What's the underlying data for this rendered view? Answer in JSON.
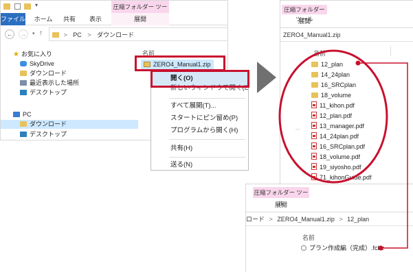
{
  "left_window": {
    "ribbon": {
      "context_header": "圧縮フォルダー ツール",
      "tabs": [
        "ファイル",
        "ホーム",
        "共有",
        "表示",
        "展開"
      ]
    },
    "address": {
      "crumb_1": "PC",
      "sep": ">",
      "crumb_2": "ダウンロード"
    },
    "nav": {
      "favorites": "お気に入り",
      "skydrive": "SkyDrive",
      "downloads": "ダウンロード",
      "recent": "最近表示した場所",
      "desktop": "デスクトップ",
      "pc": "PC",
      "pc_downloads": "ダウンロード",
      "pc_desktop": "デスクトップ"
    },
    "column_name": "名前",
    "zip_file": "ZERO4_Manual1.zip"
  },
  "context_menu": {
    "items": [
      "開く(O)",
      "新しいウィンドウで開く(E)",
      "すべて展開(T)...",
      "スタートにピン留め(P)",
      "プログラムから開く(H)",
      "共有(H)",
      "送る(N)"
    ]
  },
  "right_window": {
    "ribbon": {
      "context_header": "圧縮フォルダー ツール",
      "tab": "展開"
    },
    "address": "ZERO4_Manual1.zip",
    "column_name": "名前",
    "files": [
      {
        "name": "12_plan",
        "type": "folder"
      },
      {
        "name": "14_24plan",
        "type": "folder"
      },
      {
        "name": "16_SRCplan",
        "type": "folder"
      },
      {
        "name": "18_volume",
        "type": "folder"
      },
      {
        "name": "11_kihon.pdf",
        "type": "pdf"
      },
      {
        "name": "12_plan.pdf",
        "type": "pdf"
      },
      {
        "name": "13_manager.pdf",
        "type": "pdf"
      },
      {
        "name": "14_24plan.pdf",
        "type": "pdf"
      },
      {
        "name": "16_SRCplan.pdf",
        "type": "pdf"
      },
      {
        "name": "18_volume.pdf",
        "type": "pdf"
      },
      {
        "name": "19_siyosho.pdf",
        "type": "pdf"
      },
      {
        "name": "71_kihonGuide.pdf",
        "type": "pdf"
      }
    ]
  },
  "sub_window": {
    "ribbon": {
      "context_header": "圧縮フォルダー ツール",
      "tab": "展開"
    },
    "address": {
      "part_1": "ロード",
      "sep": ">",
      "part_2": "ZERO4_Manual1.zip",
      "part_3": "12_plan"
    },
    "column_name": "名前",
    "file": "プラン作成編（完成）.fcbz"
  },
  "colors": {
    "highlight": "#c8102e",
    "arrow": "#707070",
    "ribbon_file": "#2a6fc0",
    "context_tab": "#f9d6ec"
  }
}
